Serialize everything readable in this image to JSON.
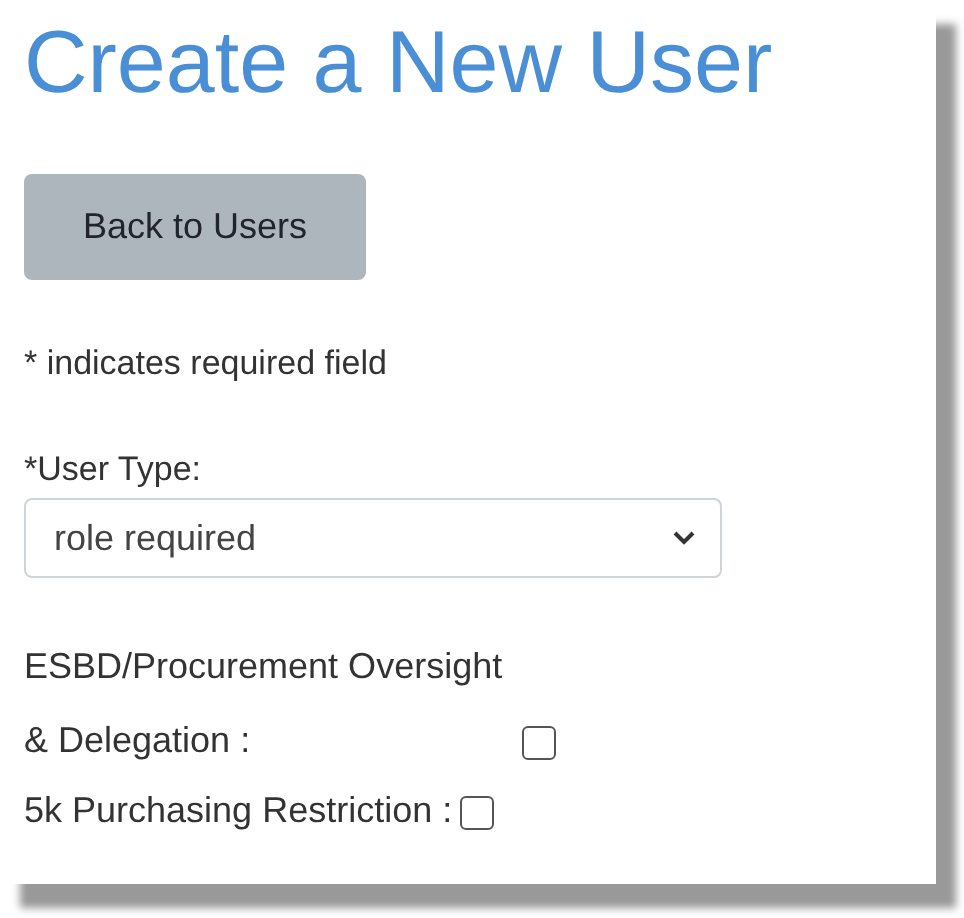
{
  "title": "Create a New User",
  "back_button": "Back to Users",
  "required_note": "* indicates required field",
  "user_type": {
    "label": "*User Type:",
    "value": "role required"
  },
  "options": [
    {
      "label": "ESBD/Procurement Oversight & Delegation :",
      "checked": false
    },
    {
      "label": "5k Purchasing Restriction :",
      "checked": false
    }
  ]
}
